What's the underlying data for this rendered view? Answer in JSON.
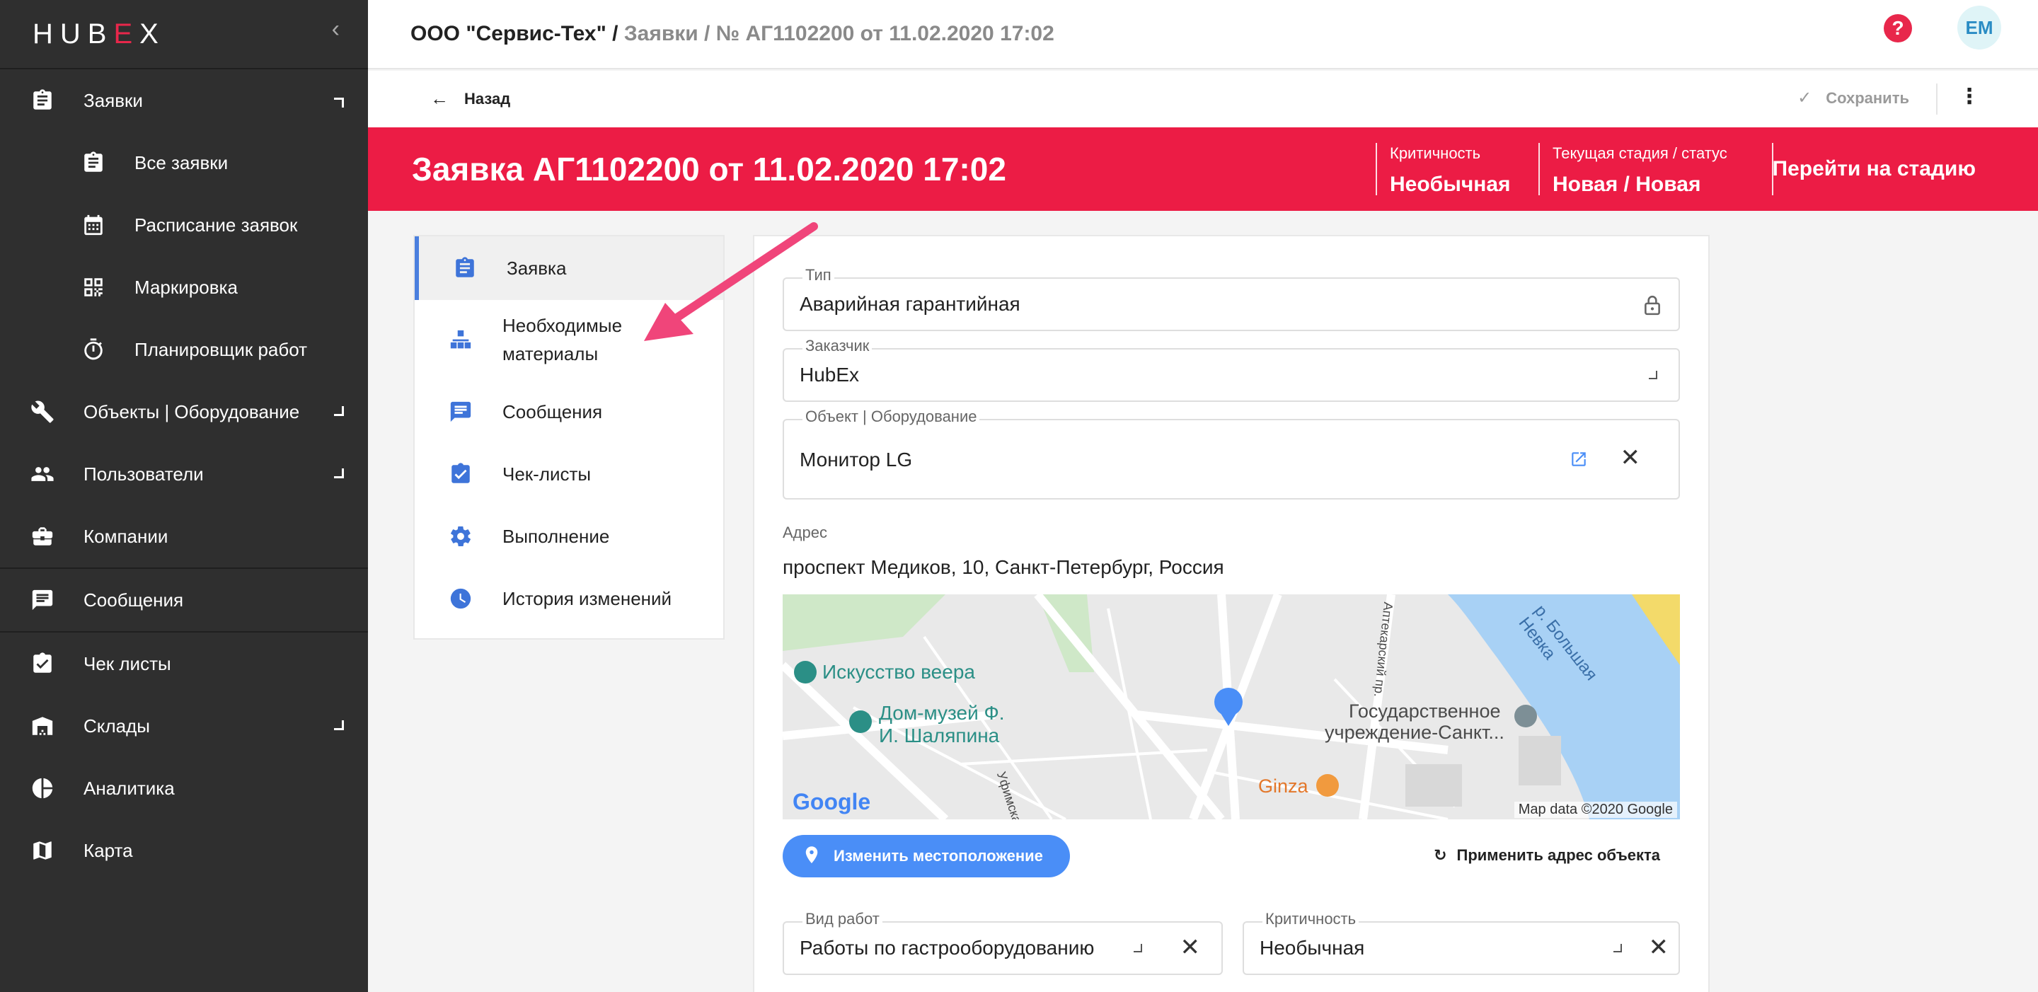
{
  "sidebar": {
    "logo_left": "HUB",
    "logo_x": "E",
    "logo_right": "X",
    "collapse_icon": "chevron-left-icon",
    "items": [
      {
        "label": "Заявки",
        "icon": "clipboard-icon",
        "expanded": true
      },
      {
        "label": "Все заявки",
        "icon": "clipboard-icon",
        "sub": true
      },
      {
        "label": "Расписание заявок",
        "icon": "calendar-icon",
        "sub": true
      },
      {
        "label": "Маркировка",
        "icon": "qr-code-icon",
        "sub": true
      },
      {
        "label": "Планировщик работ",
        "icon": "timer-icon",
        "sub": true
      },
      {
        "label": "Объекты | Оборудование",
        "icon": "wrench-icon"
      },
      {
        "label": "Пользователи",
        "icon": "users-icon"
      },
      {
        "label": "Компании",
        "icon": "briefcase-icon"
      },
      {
        "label": "Сообщения",
        "icon": "message-icon"
      },
      {
        "label": "Чек листы",
        "icon": "checklist-icon"
      },
      {
        "label": "Склады",
        "icon": "warehouse-icon"
      },
      {
        "label": "Аналитика",
        "icon": "pie-chart-icon"
      },
      {
        "label": "Карта",
        "icon": "map-icon"
      }
    ]
  },
  "topbar": {
    "company": "ООО \"Сервис-Тех\" /",
    "path": " Заявки / № АГ1102200 от 11.02.2020 17:02",
    "help": "?",
    "avatar": "EM"
  },
  "actionbar": {
    "back_label": "Назад",
    "save_label": "Сохранить"
  },
  "banner": {
    "title": "Заявка АГ1102200 от 11.02.2020 17:02",
    "criticality_label": "Критичность",
    "criticality_value": "Необычная",
    "stage_label": "Текущая стадия / статус",
    "stage_value": "Новая / Новая",
    "go_to_stage": "Перейти на стадию",
    "color": "#ec1c45"
  },
  "tabs": [
    {
      "label": "Заявка",
      "icon": "clipboard-icon",
      "active": true
    },
    {
      "label": "Необходимые",
      "label2": "материалы",
      "icon": "boxes-icon"
    },
    {
      "label": "Сообщения",
      "icon": "message-icon"
    },
    {
      "label": "Чек-листы",
      "icon": "checklist-icon"
    },
    {
      "label": "Выполнение",
      "icon": "gear-icon"
    },
    {
      "label": "История изменений",
      "icon": "history-icon"
    }
  ],
  "form": {
    "type_label": "Тип",
    "type_value": "Аварийная гарантийная",
    "customer_label": "Заказчик",
    "customer_value": "HubEx",
    "object_label": "Объект | Оборудование",
    "object_value": "Монитор LG",
    "address_label": "Адрес",
    "address_value": "проспект Медиков, 10, Санкт-Петербург, Россия",
    "work_type_label": "Вид работ",
    "work_type_value": "Работы по гастрооборудованию",
    "criticality_label": "Критичность",
    "criticality_value": "Необычная",
    "change_location": "Изменить местоположение",
    "apply_address": "Применить адрес объекта"
  },
  "map": {
    "poi1": "Искусство веера",
    "poi2a": "Дом-музей Ф.",
    "poi2b": "И. Шаляпина",
    "poi3a": "Государственное",
    "poi3b": "учреждение-Санкт...",
    "poi4": "Ginza",
    "street1": "Уфимская ул.",
    "street2": "Аптекарский пр.",
    "river": "р. Большая Невка",
    "google": "Google",
    "copyright": "Map data ©2020 Google"
  }
}
